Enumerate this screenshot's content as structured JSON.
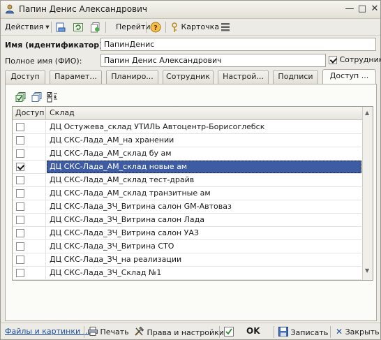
{
  "window": {
    "title": "Папин Денис Александрович",
    "controls": [
      "minimize",
      "maximize",
      "close"
    ]
  },
  "toolbar": {
    "actions_label": "Действия",
    "goto_label": "Перейти",
    "help_icon": "help-icon",
    "card_label": "Карточка"
  },
  "form": {
    "name_label": "Имя (идентификатор):",
    "name_value": "ПапинДенис",
    "fullname_label": "Полное имя (ФИО):",
    "fullname_value": "Папин Денис Александрович",
    "employee_label": "Сотрудник",
    "employee_checked": true
  },
  "tabs": [
    {
      "label": "Доступ",
      "active": false
    },
    {
      "label": "Парамет...",
      "active": false
    },
    {
      "label": "Планиро...",
      "active": false
    },
    {
      "label": "Сотрудник",
      "active": false
    },
    {
      "label": "Настрой...",
      "active": false
    },
    {
      "label": "Подписи",
      "active": false
    },
    {
      "label": "Доступ ...",
      "active": true
    }
  ],
  "grid": {
    "columns": [
      "Доступ",
      "Склад"
    ],
    "rows": [
      {
        "access": false,
        "warehouse": "ДЦ Остужева_склад УТИЛЬ Автоцентр-Борисоглебск"
      },
      {
        "access": false,
        "warehouse": "ДЦ СКС-Лада_АМ_на хранении"
      },
      {
        "access": false,
        "warehouse": "ДЦ СКС-Лада_АМ_склад бу ам"
      },
      {
        "access": true,
        "warehouse": "ДЦ СКС-Лада_АМ_склад новые ам",
        "selected": true
      },
      {
        "access": false,
        "warehouse": "ДЦ СКС-Лада_АМ_склад тест-драйв"
      },
      {
        "access": false,
        "warehouse": "ДЦ СКС-Лада_АМ_склад транзитные ам"
      },
      {
        "access": false,
        "warehouse": "ДЦ СКС-Лада_ЗЧ_Витрина салон GM-Автоваз"
      },
      {
        "access": false,
        "warehouse": "ДЦ СКС-Лада_ЗЧ_Витрина салон Лада"
      },
      {
        "access": false,
        "warehouse": "ДЦ СКС-Лада_ЗЧ_Витрина салон УАЗ"
      },
      {
        "access": false,
        "warehouse": "ДЦ СКС-Лада_ЗЧ_Витрина СТО"
      },
      {
        "access": false,
        "warehouse": "ДЦ СКС-Лада_ЗЧ_на реализации"
      },
      {
        "access": false,
        "warehouse": "ДЦ СКС-Лада_ЗЧ_Склад №1"
      }
    ]
  },
  "bottombar": {
    "files_link": "Файлы и картинки ...",
    "print_label": "Печать",
    "rights_label": "Права и настройки",
    "ok_label": "OK",
    "save_label": "Записать",
    "close_label": "Закрыть"
  },
  "colors": {
    "selection": "#3e5ca3",
    "link": "#1c4f9c",
    "window_bg": "#ecebe6"
  }
}
